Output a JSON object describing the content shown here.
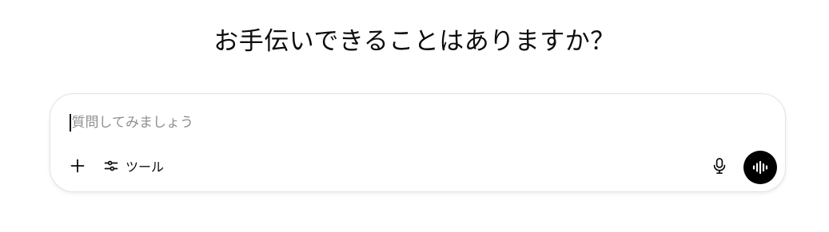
{
  "greeting": "お手伝いできることはありますか？",
  "composer": {
    "placeholder": "質問してみましょう",
    "tools_label": "ツール"
  },
  "icons": {
    "add": "plus-icon",
    "tools": "sliders-icon",
    "dictation": "microphone-icon",
    "voice_mode": "waveform-icon"
  },
  "colors": {
    "text": "#0d0d0d",
    "placeholder": "#8f8f8f",
    "border": "#e3e3e3",
    "voice_button": "#000000"
  }
}
